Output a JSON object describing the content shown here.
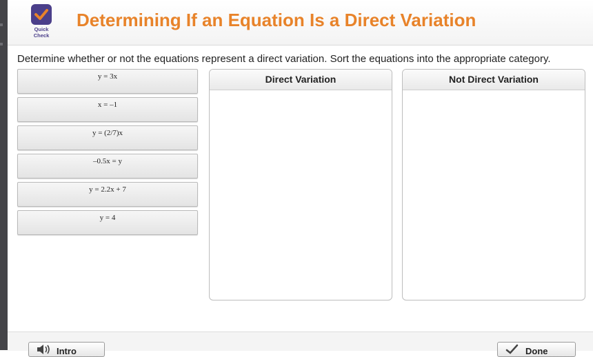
{
  "header": {
    "logo_line1": "Quick",
    "logo_line2": "Check",
    "title": "Determining If an Equation Is a Direct Variation"
  },
  "instructions": "Determine whether or not the equations represent a direct variation. Sort the equations into the appropriate category.",
  "tiles": [
    {
      "label": "y = 3x"
    },
    {
      "label": "x = –1"
    },
    {
      "label": "y = (2/7)x"
    },
    {
      "label": "–0.5x = y"
    },
    {
      "label": "y = 2.2x + 7"
    },
    {
      "label": "y = 4"
    }
  ],
  "bins": {
    "direct": "Direct Variation",
    "not_direct": "Not Direct Variation"
  },
  "footer": {
    "left_button": "Intro",
    "right_button": "Done"
  },
  "colors": {
    "title": "#e8832a",
    "brand": "#4b3f8a"
  }
}
